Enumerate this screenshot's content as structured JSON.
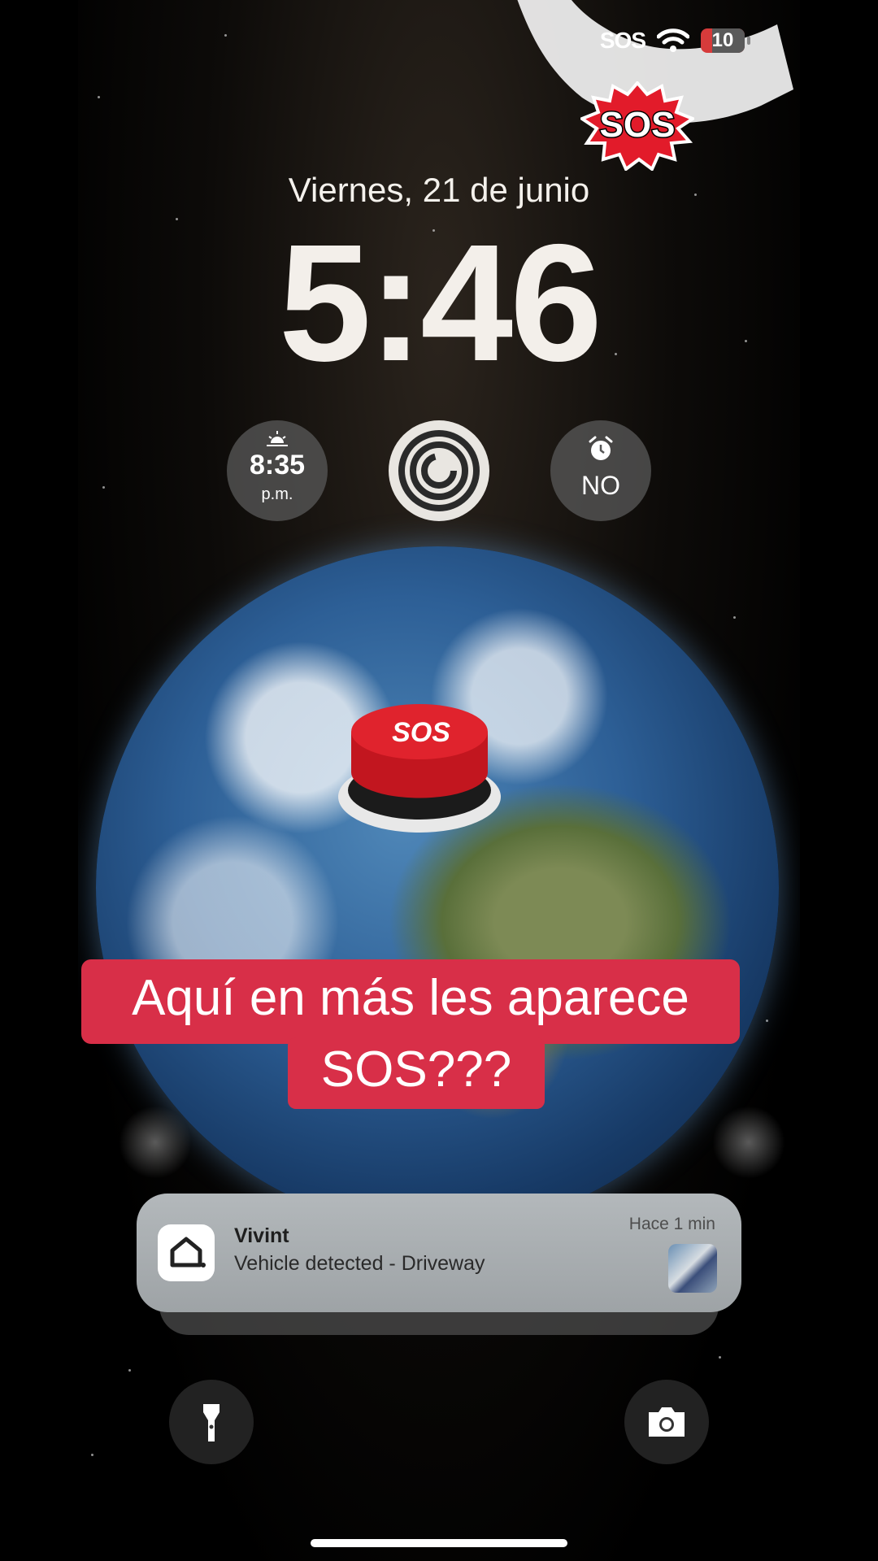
{
  "status_bar": {
    "sos_label": "SOS",
    "battery_level": "10",
    "battery_color": "#d63b3b",
    "wifi_icon": "wifi-icon"
  },
  "sticker": {
    "text": "SOS"
  },
  "lock_screen": {
    "date": "Viernes, 21 de junio",
    "time": "5:46"
  },
  "widgets": {
    "sunset": {
      "icon": "sunset-icon",
      "time": "8:35",
      "period": "p.m."
    },
    "activity": {
      "icon": "activity-rings-icon"
    },
    "alarm": {
      "icon": "alarm-clock-icon",
      "value": "NO"
    }
  },
  "sos_button": {
    "text": "SOS"
  },
  "caption": {
    "line1": "Aquí en más les aparece",
    "line2": "SOS???",
    "color": "#d82f48"
  },
  "notification": {
    "app": "Vivint",
    "message": "Vehicle detected - Driveway",
    "time": "Hace 1 min",
    "icon": "home-icon"
  },
  "quick_actions": {
    "left_icon": "flashlight-icon",
    "right_icon": "camera-icon"
  }
}
